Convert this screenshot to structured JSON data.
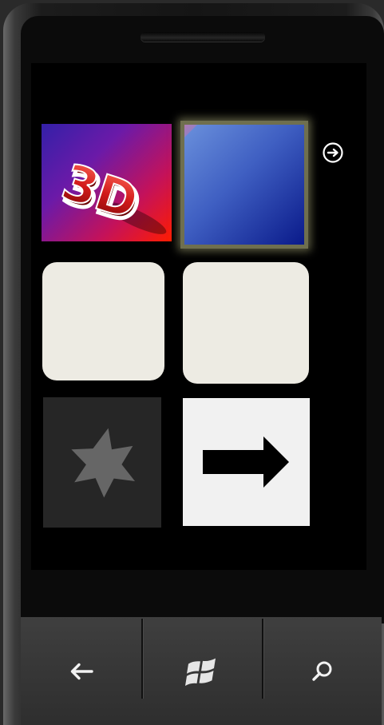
{
  "screen": {
    "tiles": [
      {
        "name": "3d-tile",
        "text": "3D"
      },
      {
        "name": "gradient-tile"
      },
      {
        "name": "blank-rounded-tile-1"
      },
      {
        "name": "blank-rounded-tile-2"
      },
      {
        "name": "star-tile",
        "icon": "star-icon"
      },
      {
        "name": "arrow-tile",
        "icon": "right-arrow-icon"
      }
    ],
    "page_nav_icon": "circle-arrow-right-icon"
  },
  "navbar": {
    "back_icon": "back-arrow-icon",
    "start_icon": "windows-logo-icon",
    "search_icon": "search-icon"
  },
  "colors": {
    "tile_light": "#edebe3",
    "tile_dark": "#262626",
    "gradient_blue": "#3f5fc2",
    "tile_3d_magenta": "#c4125a",
    "glow": "#aaaa78"
  }
}
